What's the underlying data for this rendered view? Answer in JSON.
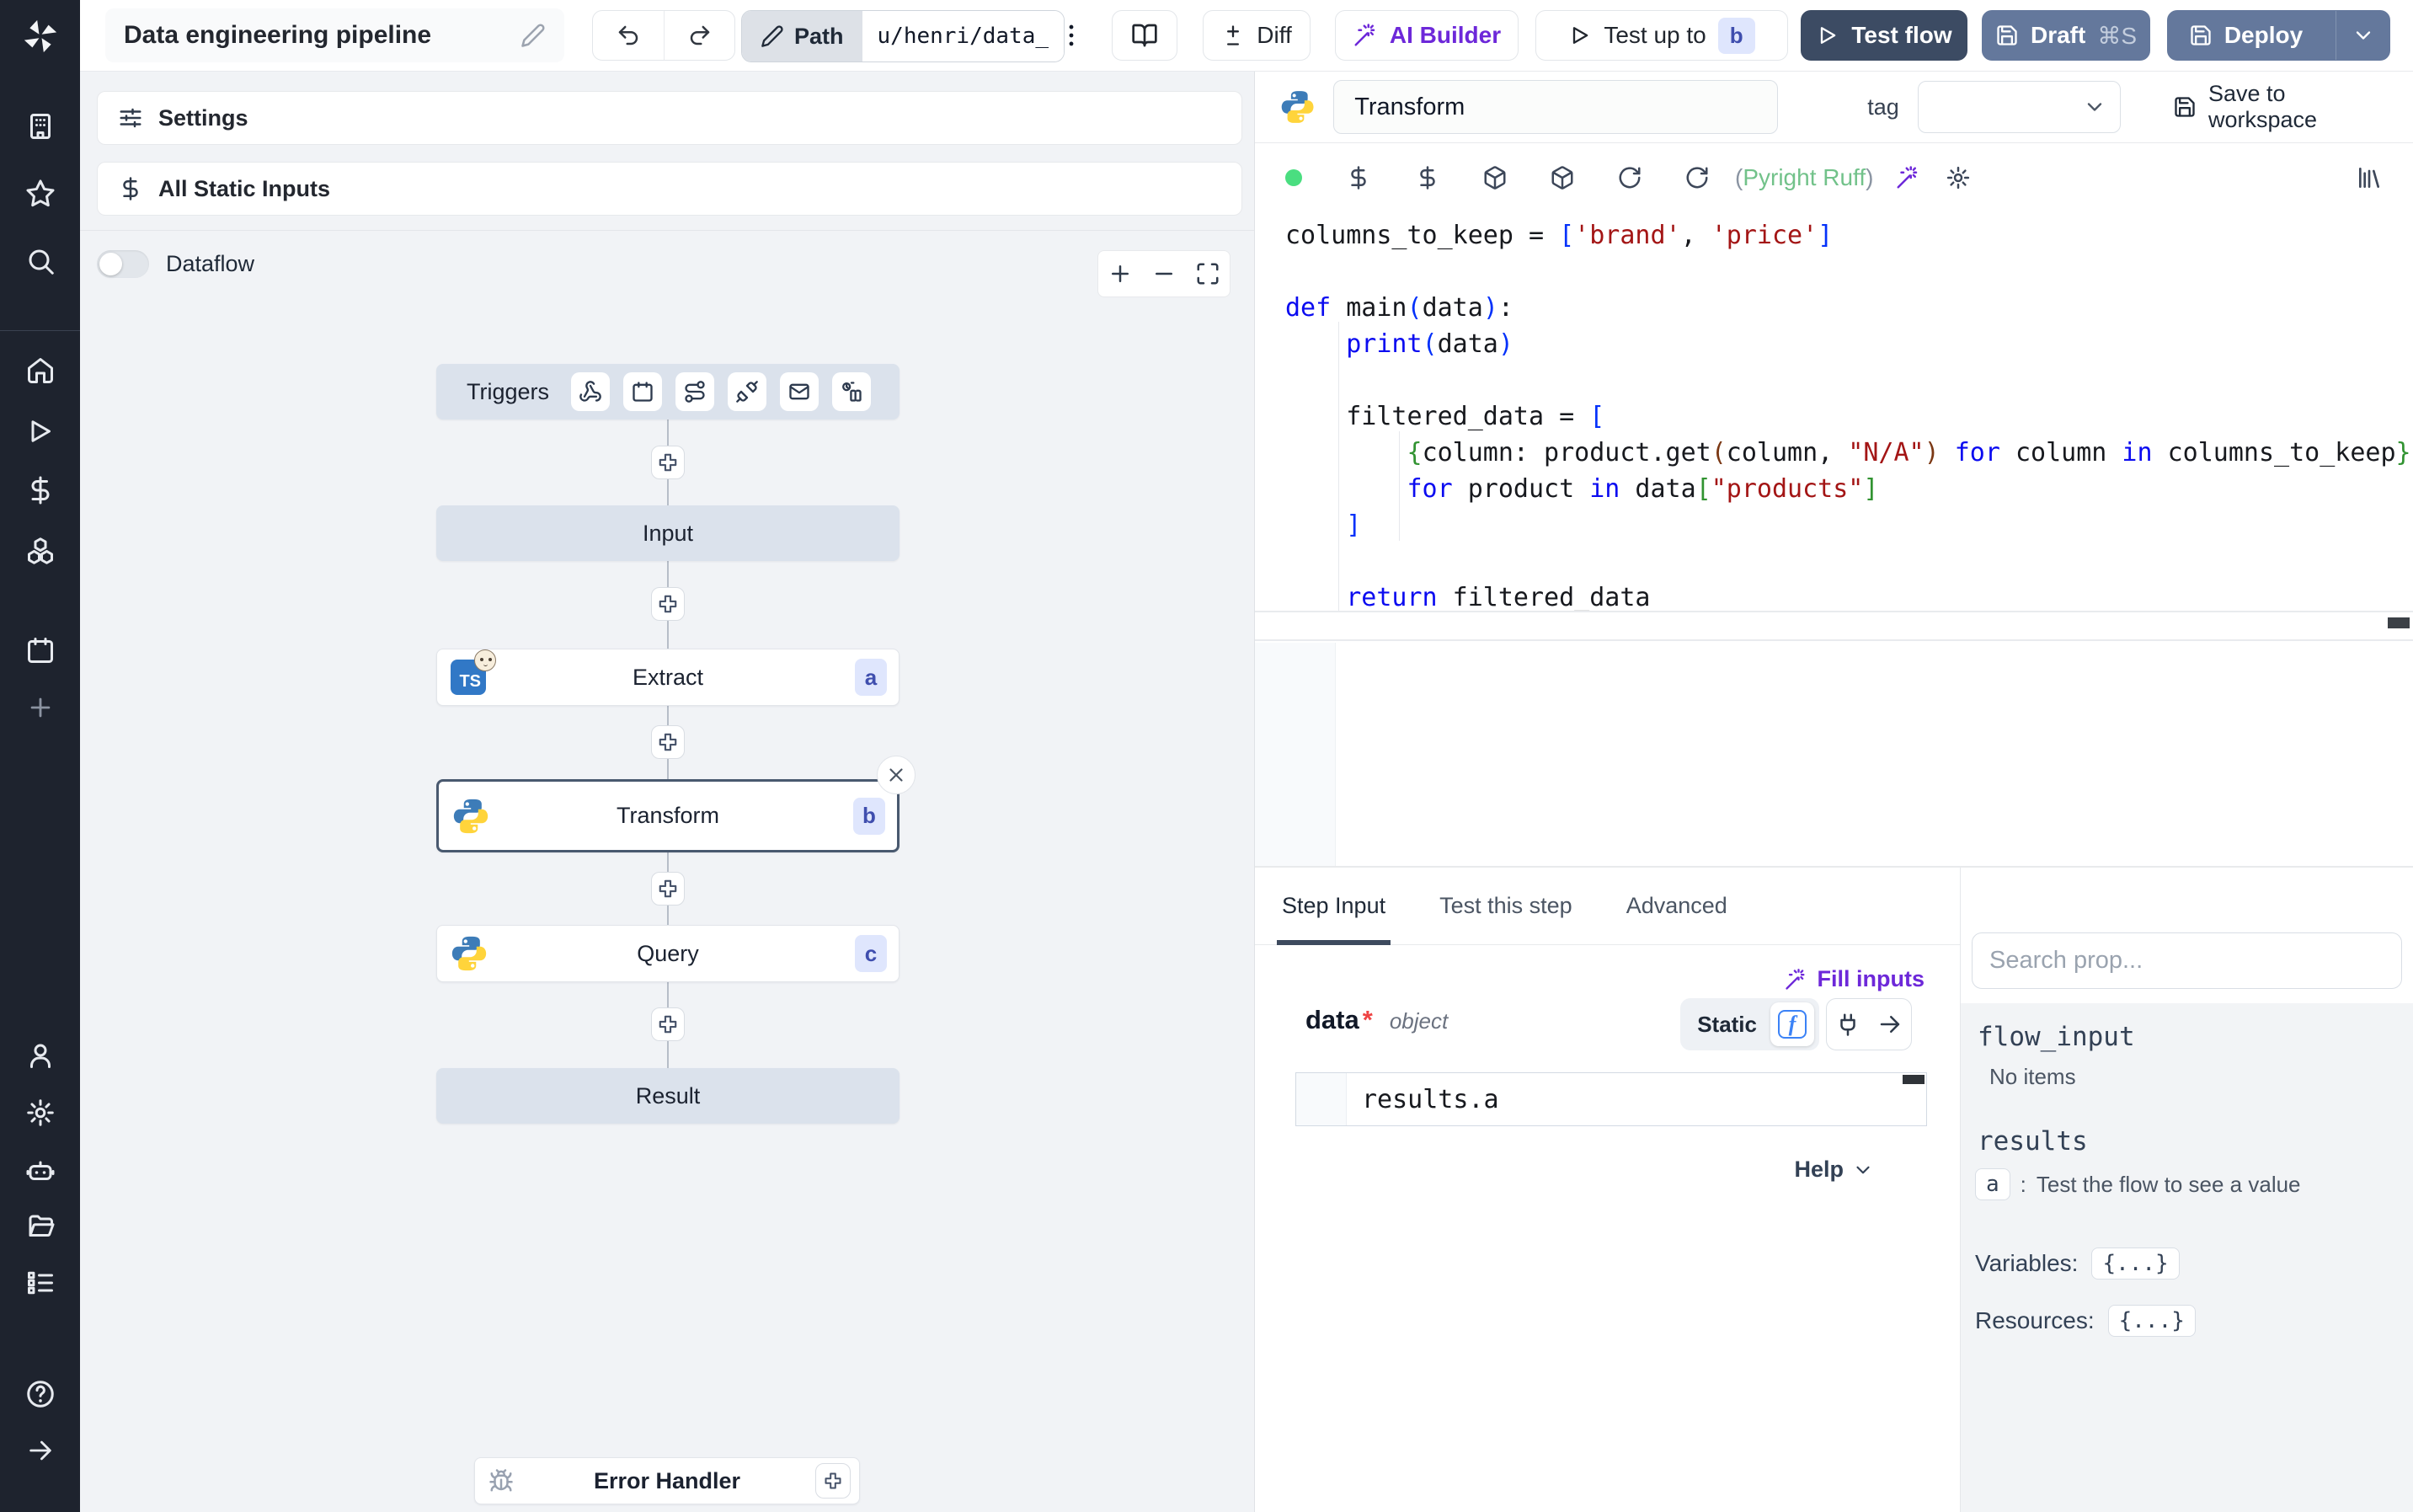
{
  "topbar": {
    "title": "Data engineering pipeline",
    "path_label": "Path",
    "path_value": "u/henri/data_",
    "diff_label": "Diff",
    "ai_builder_label": "AI Builder",
    "test_up_to_label": "Test up to",
    "test_up_to_badge": "b",
    "test_flow_label": "Test flow",
    "draft_label": "Draft",
    "draft_shortcut": "⌘S",
    "deploy_label": "Deploy"
  },
  "flow_panel": {
    "settings_label": "Settings",
    "static_inputs_label": "All Static Inputs",
    "dataflow_label": "Dataflow",
    "triggers_label": "Triggers",
    "input_label": "Input",
    "result_label": "Result",
    "error_handler_label": "Error Handler",
    "nodes": [
      {
        "label": "Extract",
        "badge": "a"
      },
      {
        "label": "Transform",
        "badge": "b"
      },
      {
        "label": "Query",
        "badge": "c"
      }
    ]
  },
  "editor": {
    "step_name": "Transform",
    "tag_label": "tag",
    "save_label": "Save to workspace",
    "lint_open": "(",
    "lint_text": "Pyright Ruff",
    "lint_close": ")",
    "code_lines": [
      [
        [
          "t",
          "columns_to_keep = "
        ],
        [
          "b1",
          "["
        ],
        [
          "s",
          "'brand'"
        ],
        [
          "t",
          ", "
        ],
        [
          "s",
          "'price'"
        ],
        [
          "b1",
          "]"
        ]
      ],
      [],
      [
        [
          "k",
          "def"
        ],
        [
          "t",
          " main"
        ],
        [
          "b1",
          "("
        ],
        [
          "t",
          "data"
        ],
        [
          "b1",
          ")"
        ],
        [
          "t",
          ":"
        ]
      ],
      [
        [
          "t",
          "    "
        ],
        [
          "k",
          "print"
        ],
        [
          "b1",
          "("
        ],
        [
          "t",
          "data"
        ],
        [
          "b1",
          ")"
        ]
      ],
      [],
      [
        [
          "t",
          "    filtered_data = "
        ],
        [
          "b1",
          "["
        ]
      ],
      [
        [
          "t",
          "        "
        ],
        [
          "b2",
          "{"
        ],
        [
          "t",
          "column: product.get"
        ],
        [
          "b3",
          "("
        ],
        [
          "t",
          "column, "
        ],
        [
          "s",
          "\"N/A\""
        ],
        [
          "b3",
          ")"
        ],
        [
          "t",
          " "
        ],
        [
          "k",
          "for"
        ],
        [
          "t",
          " column "
        ],
        [
          "k",
          "in"
        ],
        [
          "t",
          " columns_to_keep"
        ],
        [
          "b2",
          "}"
        ]
      ],
      [
        [
          "t",
          "        "
        ],
        [
          "k",
          "for"
        ],
        [
          "t",
          " product "
        ],
        [
          "k",
          "in"
        ],
        [
          "t",
          " data"
        ],
        [
          "b2",
          "["
        ],
        [
          "s",
          "\"products\""
        ],
        [
          "b2",
          "]"
        ]
      ],
      [
        [
          "t",
          "    "
        ],
        [
          "b1",
          "]"
        ]
      ],
      [],
      [
        [
          "t",
          "    "
        ],
        [
          "k",
          "return"
        ],
        [
          "t",
          " filtered_data"
        ]
      ]
    ]
  },
  "tabs": {
    "step_input": "Step Input",
    "test_step": "Test this step",
    "advanced": "Advanced"
  },
  "step_input": {
    "fill_inputs_label": "Fill inputs",
    "arg_name": "data",
    "arg_required": "*",
    "arg_type": "object",
    "static_label": "Static",
    "expr_value": "results.a",
    "help_label": "Help"
  },
  "props_panel": {
    "search_placeholder": "Search prop...",
    "flow_input_label": "flow_input",
    "no_items_label": "No items",
    "results_label": "results",
    "result_key": "a",
    "result_sep": ":",
    "result_hint": "Test the flow to see a value",
    "variables_label": "Variables:",
    "variables_value": "{...}",
    "resources_label": "Resources:",
    "resources_value": "{...}"
  },
  "colors": {
    "accent_purple": "#6d28d9",
    "navy": "#3c4b63",
    "steel": "#64789c",
    "green_dot": "#4ade80",
    "badge_indigo": "#3f4eae",
    "sidebar_dark": "#1e232e"
  }
}
